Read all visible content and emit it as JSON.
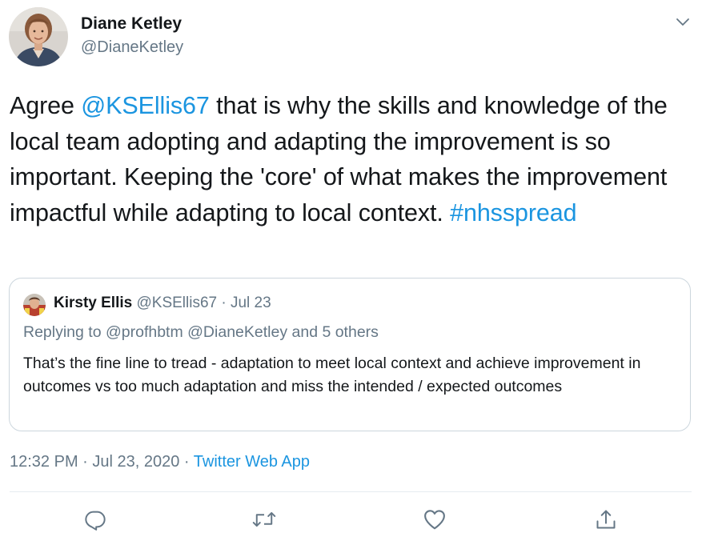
{
  "author": {
    "name": "Diane Ketley",
    "handle": "@DianeKetley"
  },
  "tweet": {
    "text_prefix": "Agree ",
    "mention": "@KSEllis67",
    "text_main": " that is why the skills and knowledge of the local team adopting and adapting the improvement is so important. Keeping the 'core' of what makes the improvement impactful while adapting to local context. ",
    "hashtag": "#nhsspread"
  },
  "quoted_tweet": {
    "name": "Kirsty Ellis",
    "meta": "@KSEllis67 · Jul 23",
    "replying_to": "Replying to @profhbtm @DianeKetley and 5 others",
    "text": "That’s the fine line to tread - adaptation to meet local context and achieve improvement in outcomes vs too much adaptation and miss the intended / expected outcomes"
  },
  "timestamp": {
    "time_date": "12:32 PM · Jul 23, 2020 · ",
    "source": "Twitter Web App"
  },
  "icons": {
    "menu": "chevron-down-icon",
    "reply": "reply-icon",
    "retweet": "retweet-icon",
    "like": "heart-icon",
    "share": "share-icon"
  },
  "colors": {
    "link": "#1b95e0",
    "muted": "#657786",
    "border": "#ccd6dd"
  }
}
